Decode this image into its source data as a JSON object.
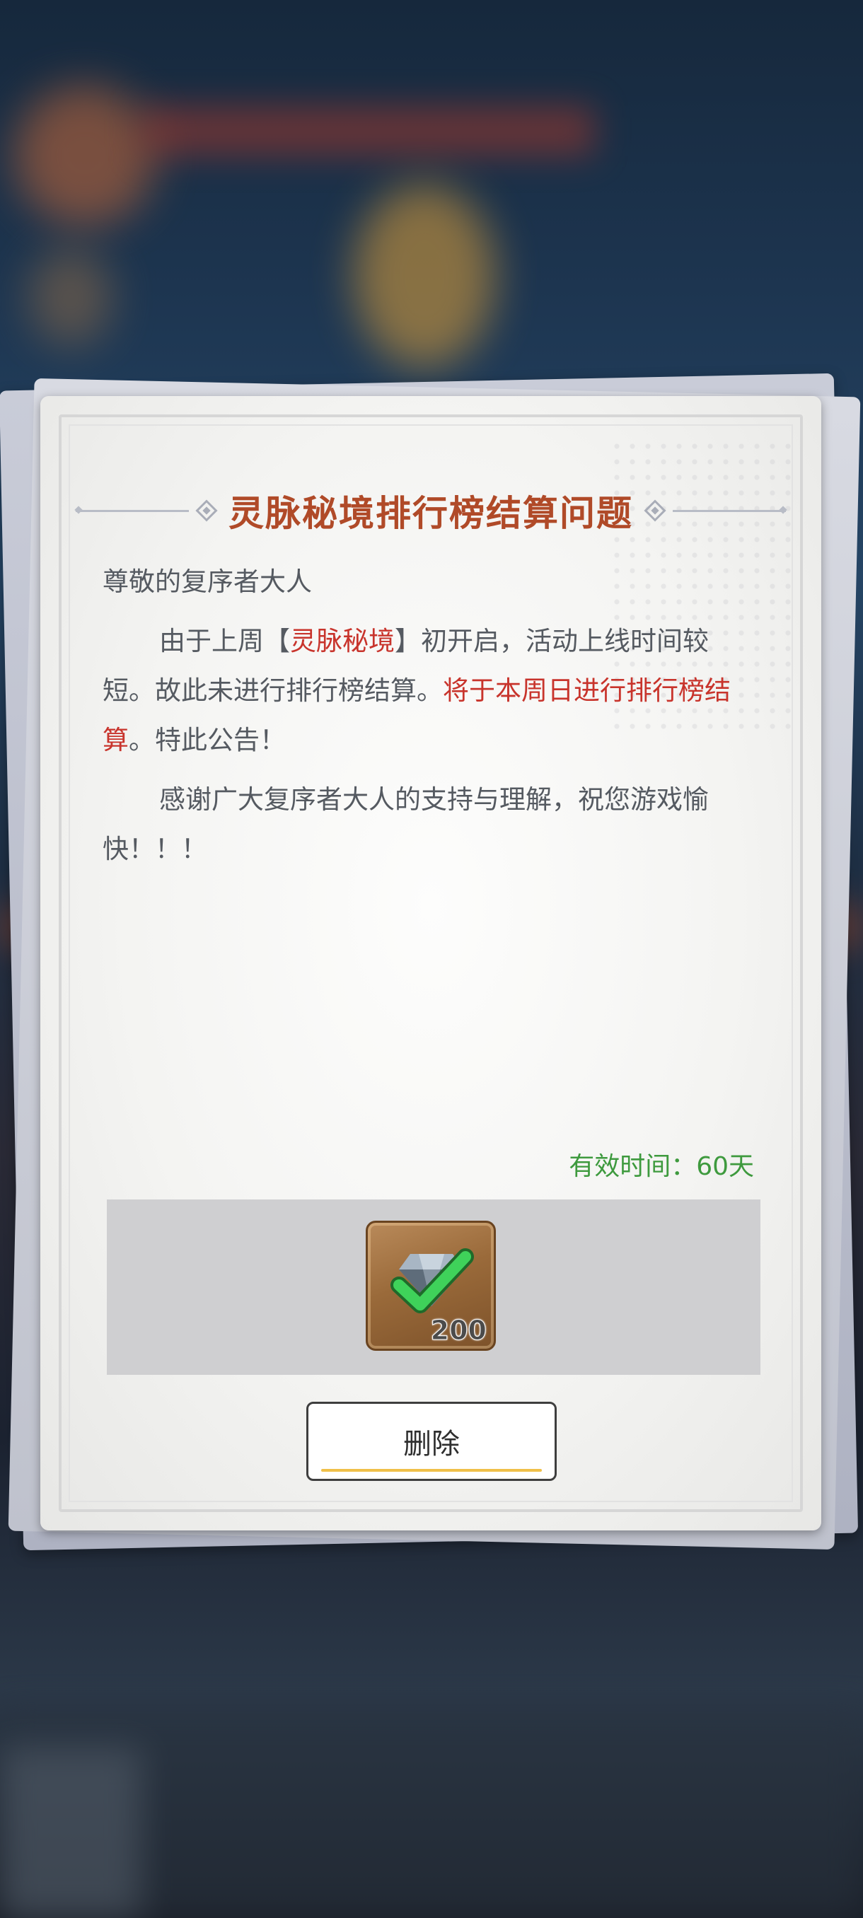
{
  "mail": {
    "title": "灵脉秘境排行榜结算问题",
    "greeting": "尊敬的复序者大人",
    "para1": {
      "part1": "由于上周【",
      "highlight1": "灵脉秘境",
      "part2": "】初开启，活动上线时间较短。故此未进行排行榜结算。",
      "highlight2": "将于本周日进行排行榜结算",
      "part3": "。特此公告！"
    },
    "para2": "感谢广大复序者大人的支持与理解，祝您游戏愉快！！！",
    "validity": "有效时间：60天"
  },
  "reward": {
    "icon": "diamond-gem-icon",
    "count": "200",
    "claimed": true
  },
  "actions": {
    "delete_label": "删除"
  },
  "colors": {
    "title": "#b04a28",
    "highlight": "#c8342c",
    "validity": "#3e9a3e",
    "button_accent": "#f0c04a"
  }
}
